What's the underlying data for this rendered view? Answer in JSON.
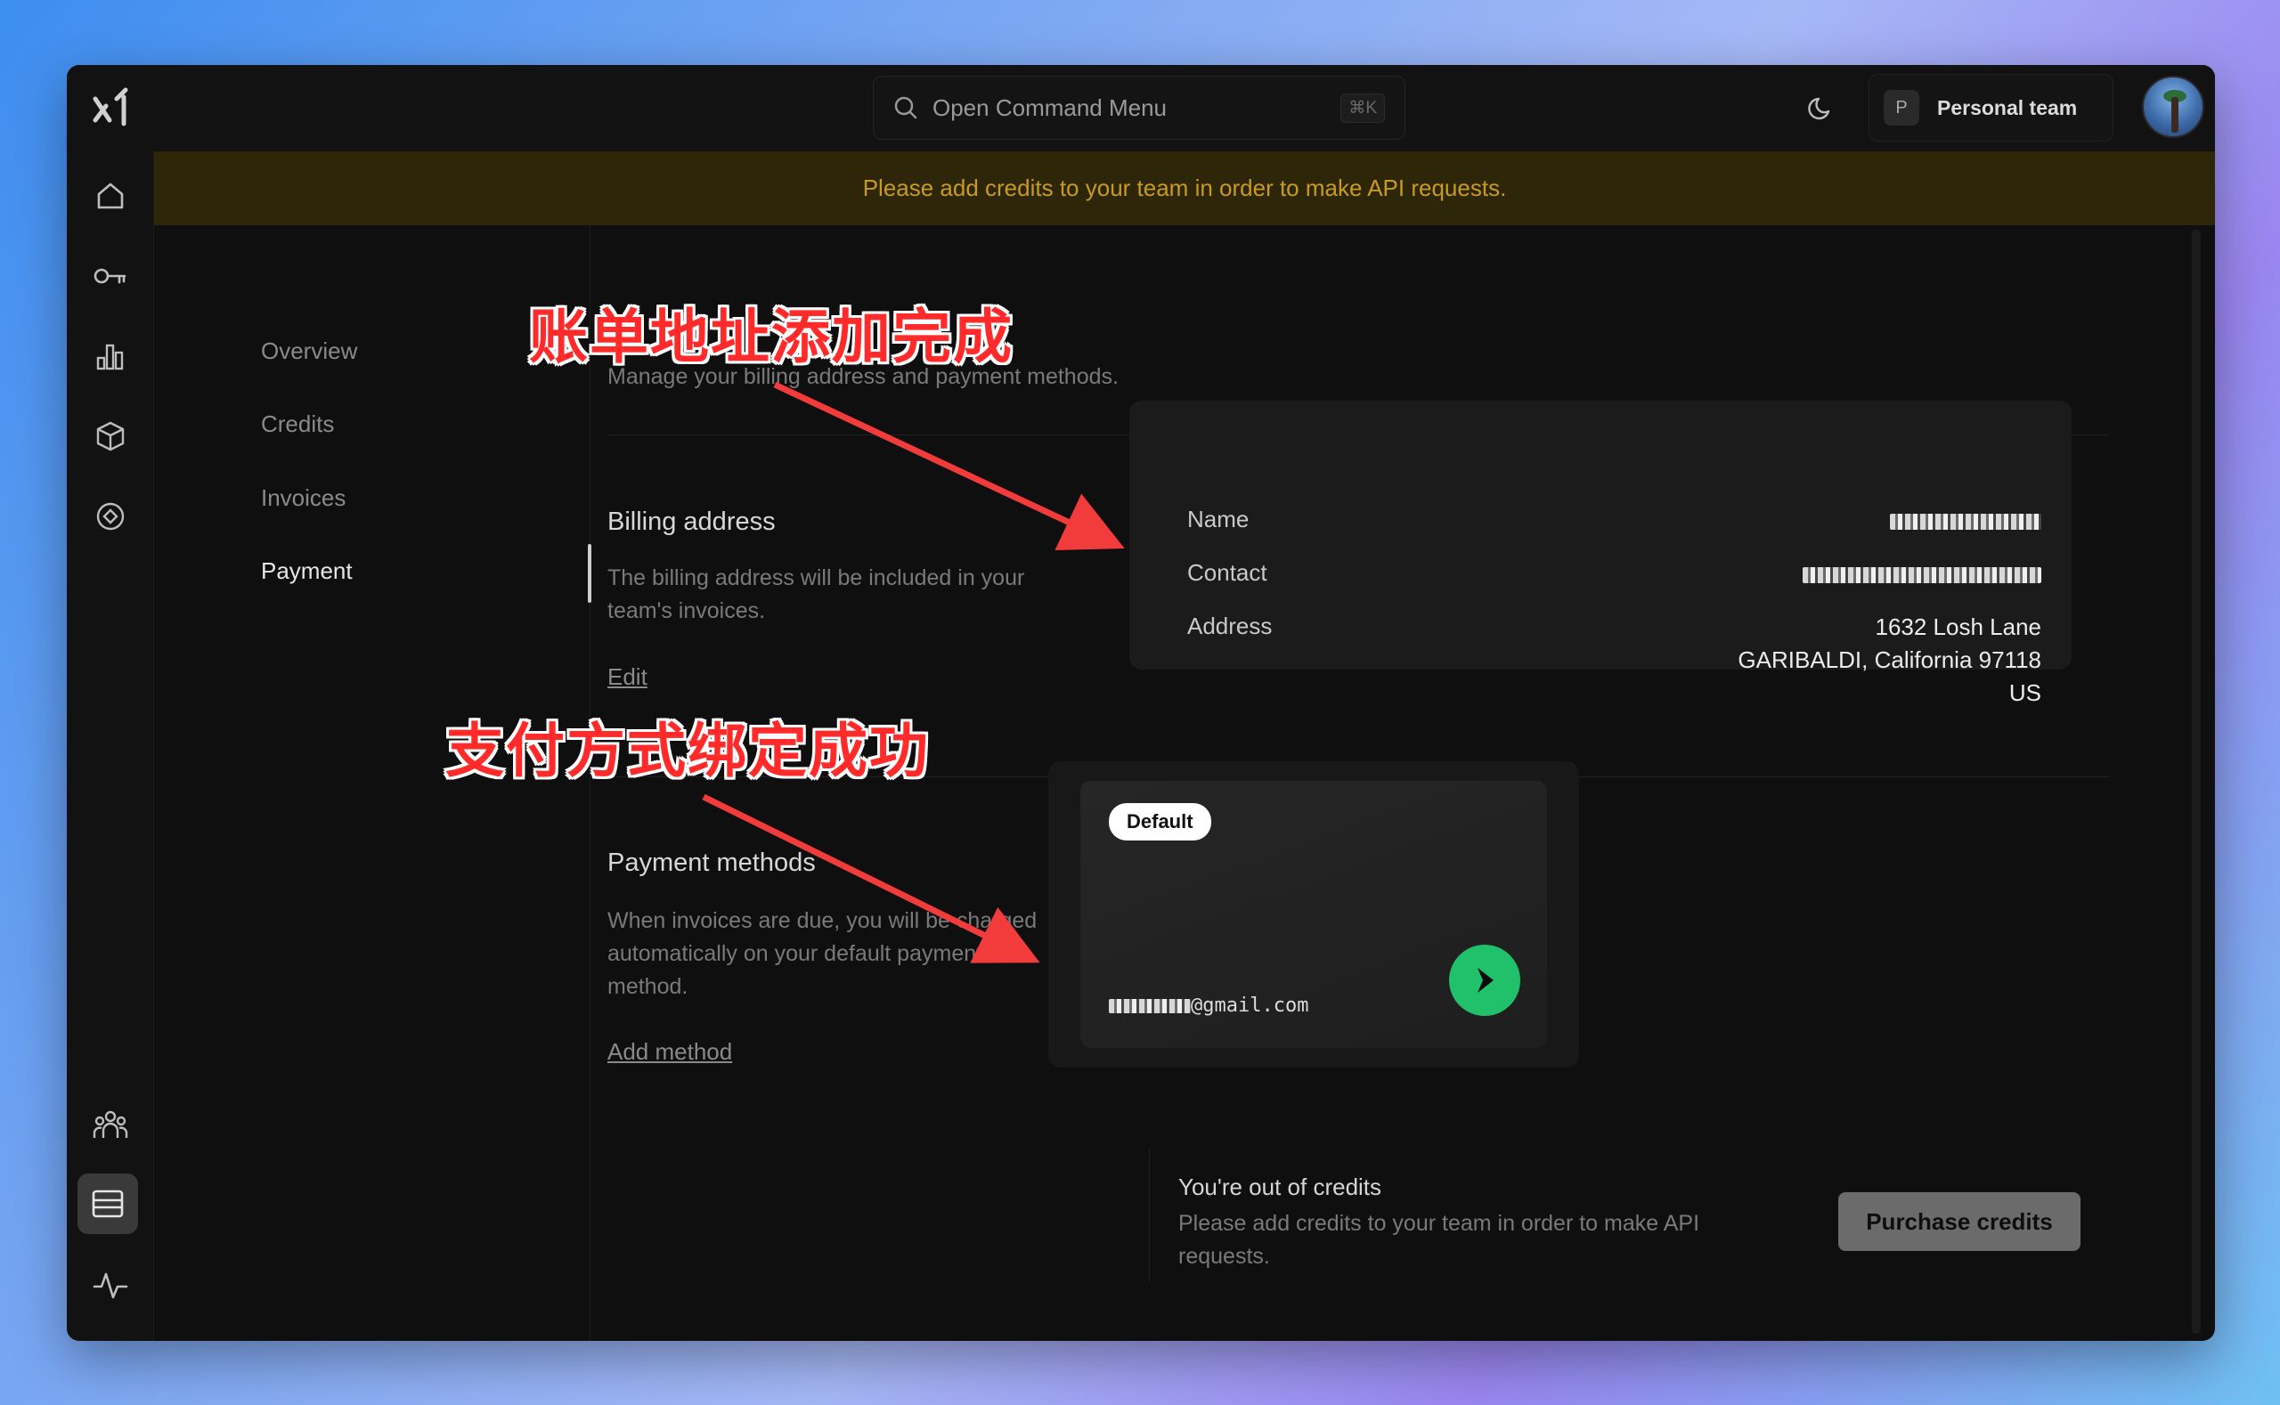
{
  "topbar": {
    "command_menu_label": "Open Command Menu",
    "command_menu_shortcut": "⌘K",
    "team_initial": "P",
    "team_name": "Personal team"
  },
  "banner": {
    "text": "Please add credits to your team in order to make API requests."
  },
  "subnav": {
    "items": [
      {
        "label": "Overview"
      },
      {
        "label": "Credits"
      },
      {
        "label": "Invoices"
      },
      {
        "label": "Payment"
      }
    ],
    "active": "Payment"
  },
  "page": {
    "subtitle": "Manage your billing address and payment methods."
  },
  "billing": {
    "title": "Billing address",
    "description": "The billing address will be included in your team's invoices.",
    "edit_label": "Edit",
    "fields": {
      "name_label": "Name",
      "contact_label": "Contact",
      "address_label": "Address",
      "address_line1": "1632 Losh Lane",
      "address_line2": "GARIBALDI, California 97118",
      "address_line3": "US"
    }
  },
  "payment_methods": {
    "title": "Payment methods",
    "description": "When invoices are due, you will be charged automatically on your default payment method.",
    "add_label": "Add method",
    "card": {
      "badge": "Default",
      "email_suffix": "@gmail.com"
    }
  },
  "credits_notice": {
    "title": "You're out of credits",
    "description": "Please add credits to your team in order to make API requests.",
    "button_label": "Purchase credits"
  },
  "annotations": {
    "billing_done": "账单地址添加完成",
    "payment_done": "支付方式绑定成功"
  },
  "colors": {
    "banner_bg": "#2e2609",
    "banner_text": "#c79a24",
    "annotation_red": "#ff2a2a",
    "payment_logo_green": "#21c16b"
  }
}
